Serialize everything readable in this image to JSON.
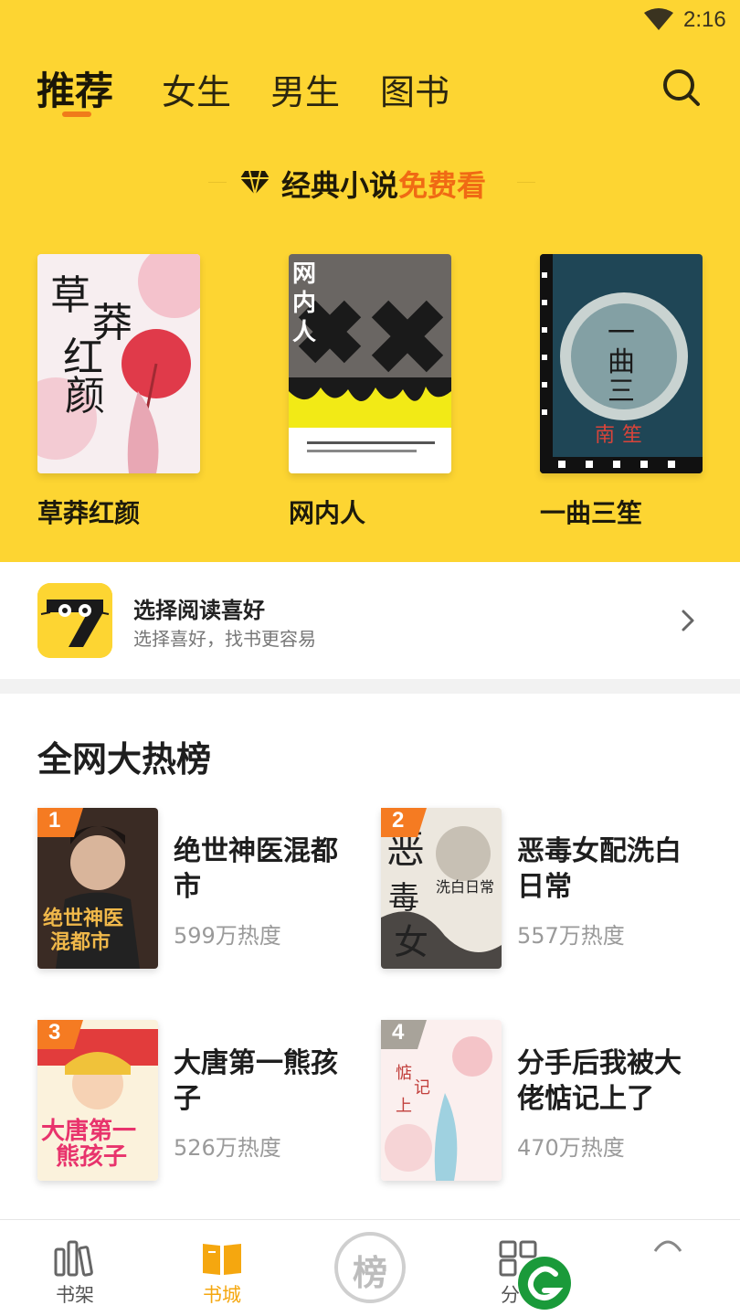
{
  "status_bar": {
    "time": "2:16"
  },
  "tabs": [
    {
      "label": "推荐",
      "active": true
    },
    {
      "label": "女生",
      "active": false
    },
    {
      "label": "男生",
      "active": false
    },
    {
      "label": "图书",
      "active": false
    }
  ],
  "promo": {
    "prefix": "经典小说",
    "highlight": "免费看",
    "icon": "diamond-icon"
  },
  "featured_books": [
    {
      "title": "草莽红颜"
    },
    {
      "title": "网内人"
    },
    {
      "title": "一曲三笙"
    }
  ],
  "preference": {
    "title": "选择阅读喜好",
    "subtitle": "选择喜好，找书更容易"
  },
  "ranking": {
    "title": "全网大热榜",
    "items": [
      {
        "rank": "1",
        "name": "绝世神医混都市",
        "heat": "599万热度",
        "badge_color": "#f57b22"
      },
      {
        "rank": "2",
        "name": "恶毒女配洗白日常",
        "heat": "557万热度",
        "badge_color": "#f57b22"
      },
      {
        "rank": "3",
        "name": "大唐第一熊孩子",
        "heat": "526万热度",
        "badge_color": "#f57b22"
      },
      {
        "rank": "4",
        "name": "分手后我被大佬惦记上了",
        "heat": "470万热度",
        "badge_color": "#a8a39a"
      }
    ]
  },
  "bottom_nav": [
    {
      "label": "书架",
      "icon": "bookshelf-icon",
      "active": false
    },
    {
      "label": "书城",
      "icon": "book-open-icon",
      "active": true
    },
    {
      "label": "榜",
      "icon": "rank-icon",
      "active": false
    },
    {
      "label": "分",
      "icon": "category-icon",
      "active": false
    }
  ],
  "colors": {
    "brand_yellow": "#fdd532",
    "accent_orange": "#f06a14",
    "active_nav": "#f5a70f"
  }
}
